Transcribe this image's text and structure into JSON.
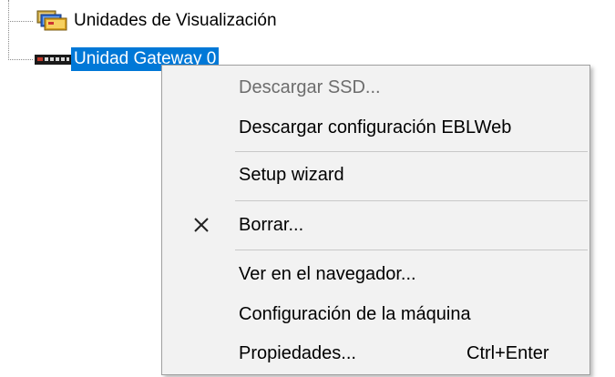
{
  "tree": {
    "nodes": [
      {
        "label": "Unidades de Visualización",
        "icon": "display-units-icon",
        "selected": false
      },
      {
        "label": "Unidad Gateway 0",
        "icon": "gateway-device-icon",
        "selected": true
      }
    ]
  },
  "context_menu": {
    "items": [
      {
        "label": "Descargar SSD...",
        "enabled": false
      },
      {
        "label": "Descargar configuración EBLWeb",
        "enabled": true
      },
      {
        "label": "Setup wizard",
        "enabled": true
      },
      {
        "label": "Borrar...",
        "enabled": true,
        "icon": "delete-x-icon"
      },
      {
        "label": "Ver en el navegador...",
        "enabled": true
      },
      {
        "label": "Configuración de la máquina",
        "enabled": true
      },
      {
        "label": "Propiedades...",
        "enabled": true,
        "shortcut": "Ctrl+Enter"
      }
    ]
  },
  "colors": {
    "selection": "#0078d7",
    "menu_background": "#f2f2f2",
    "disabled_text": "#6d6d6d"
  }
}
